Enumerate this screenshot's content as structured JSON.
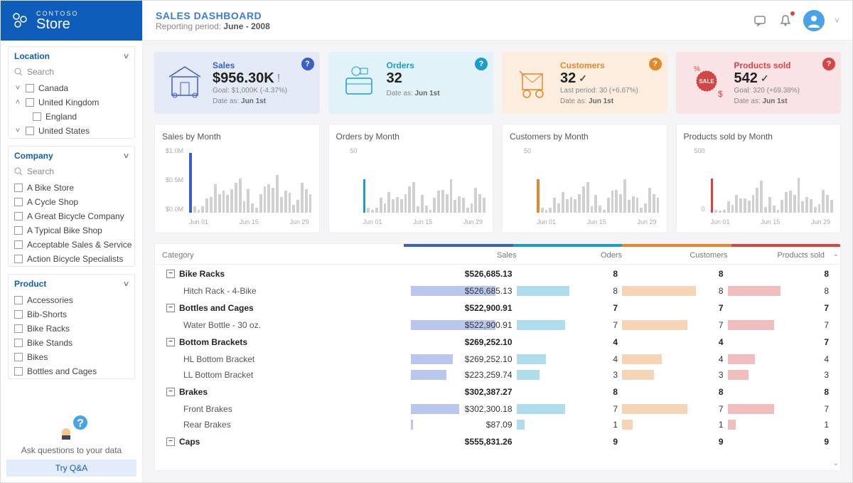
{
  "brand": {
    "sub": "CONTOSO",
    "main": "Store"
  },
  "header": {
    "title": "SALES DASHBOARD",
    "sub_prefix": "Reporting period:",
    "sub_period": "June - 2008"
  },
  "filters": {
    "location": {
      "title": "Location",
      "search": "Search",
      "items": [
        {
          "label": "Canada",
          "indent": 0,
          "carat": "˅"
        },
        {
          "label": "United Kingdom",
          "indent": 0,
          "carat": "˄"
        },
        {
          "label": "England",
          "indent": 1,
          "carat": ""
        },
        {
          "label": "United States",
          "indent": 0,
          "carat": "˅"
        }
      ]
    },
    "company": {
      "title": "Company",
      "search": "Search",
      "items": [
        {
          "label": "A Bike Store"
        },
        {
          "label": "A Cycle Shop"
        },
        {
          "label": "A Great Bicycle Company"
        },
        {
          "label": "A Typical Bike Shop"
        },
        {
          "label": "Acceptable Sales & Service"
        },
        {
          "label": "Action Bicycle Specialists"
        }
      ]
    },
    "product": {
      "title": "Product",
      "items": [
        {
          "label": "Accessories"
        },
        {
          "label": "Bib-Shorts"
        },
        {
          "label": "Bike Racks"
        },
        {
          "label": "Bike Stands"
        },
        {
          "label": "Bikes"
        },
        {
          "label": "Bottles and Cages"
        }
      ]
    }
  },
  "qa": {
    "text": "Ask questions to your data",
    "button": "Try Q&A"
  },
  "kpis": {
    "sales": {
      "label": "Sales",
      "value": "$956.30K",
      "sub": "Goal: $1,000K (-4.37%)",
      "date_prefix": "Date as:",
      "date": "Jun 1st",
      "icon": "!"
    },
    "orders": {
      "label": "Orders",
      "value": "32",
      "sub": "",
      "date_prefix": "Date as:",
      "date": "Jun 1st"
    },
    "customers": {
      "label": "Customers",
      "value": "32",
      "sub": "Last period: 30 (+6.67%)",
      "date_prefix": "Date as:",
      "date": "Jun 1st",
      "icon": "✓"
    },
    "products": {
      "label": "Products sold",
      "value": "542",
      "sub": "Goal: 320 (+69.38%)",
      "date_prefix": "Date as:",
      "date": "Jun 1st",
      "icon": "✓"
    }
  },
  "chart_data": [
    {
      "type": "bar",
      "title": "Sales by Month",
      "ylabel": "",
      "ylim": [
        0,
        1.0
      ],
      "yticks": [
        "$1.0M",
        "$0.5M",
        "$0.0M"
      ],
      "xticks": [
        "Jun 01",
        "Jun 15",
        "Jun 29"
      ],
      "highlight": 0,
      "hlclass": "hl-blue",
      "values": [
        0.96,
        0.1,
        0.05,
        0.1,
        0.23,
        0.25,
        0.45,
        0.3,
        0.35,
        0.28,
        0.38,
        0.48,
        0.55,
        0.18,
        0.38,
        0.15,
        0.08,
        0.3,
        0.42,
        0.45,
        0.4,
        0.6,
        0.25,
        0.35,
        0.32,
        0.12,
        0.2,
        0.48,
        0.38,
        0.3
      ]
    },
    {
      "type": "bar",
      "title": "Orders by Month",
      "ylabel": "",
      "ylim": [
        0,
        60
      ],
      "yticks": [
        "50"
      ],
      "xticks": [
        "Jun 01",
        "Jun 15",
        "Jun 29"
      ],
      "highlight": 0,
      "hlclass": "hl-cyan",
      "values": [
        32,
        5,
        3,
        5,
        14,
        9,
        20,
        13,
        15,
        13,
        18,
        25,
        29,
        6,
        17,
        7,
        3,
        14,
        21,
        22,
        18,
        32,
        12,
        16,
        14,
        5,
        9,
        24,
        18,
        14
      ]
    },
    {
      "type": "bar",
      "title": "Customers by Month",
      "ylabel": "",
      "ylim": [
        0,
        60
      ],
      "yticks": [
        "50"
      ],
      "xticks": [
        "Jun 01",
        "Jun 15",
        "Jun 29"
      ],
      "highlight": 0,
      "hlclass": "hl-orange",
      "values": [
        32,
        5,
        3,
        5,
        14,
        9,
        20,
        13,
        15,
        13,
        18,
        25,
        29,
        6,
        17,
        7,
        3,
        14,
        21,
        22,
        18,
        32,
        12,
        16,
        14,
        5,
        9,
        24,
        18,
        14
      ]
    },
    {
      "type": "bar",
      "title": "Products sold by Month",
      "ylabel": "",
      "ylim": [
        0,
        1000
      ],
      "yticks": [
        "500",
        "0"
      ],
      "xticks": [
        "Jun 01",
        "Jun 15",
        "Jun 29"
      ],
      "highlight": 0,
      "hlclass": "hl-red",
      "values": [
        542,
        44,
        30,
        40,
        180,
        120,
        280,
        230,
        230,
        190,
        280,
        400,
        510,
        90,
        250,
        110,
        40,
        210,
        330,
        350,
        280,
        560,
        180,
        250,
        220,
        90,
        140,
        360,
        280,
        200
      ]
    }
  ],
  "table": {
    "columns": [
      "Category",
      "Sales",
      "Oders",
      "Customers",
      "Products sold"
    ],
    "rows": [
      {
        "type": "cat",
        "label": "Bike Racks",
        "sales": "$526,685.13",
        "orders": "8",
        "customers": "8",
        "products": "8"
      },
      {
        "type": "sub",
        "label": "Hitch Rack - 4-Bike",
        "sales": "$526,685.13",
        "orders": "8",
        "customers": "8",
        "products": "8",
        "bars": {
          "s": 80,
          "o": 50,
          "c": 70,
          "p": 50
        }
      },
      {
        "type": "cat",
        "label": "Bottles and Cages",
        "sales": "$522,900.91",
        "orders": "7",
        "customers": "7",
        "products": "7"
      },
      {
        "type": "sub",
        "label": "Water Bottle - 30 oz.",
        "sales": "$522,900.91",
        "orders": "7",
        "customers": "7",
        "products": "7",
        "bars": {
          "s": 80,
          "o": 46,
          "c": 62,
          "p": 44
        }
      },
      {
        "type": "cat",
        "label": "Bottom Brackets",
        "sales": "$269,252.10",
        "orders": "4",
        "customers": "4",
        "products": "7"
      },
      {
        "type": "sub",
        "label": "HL Bottom Bracket",
        "sales": "$269,252.10",
        "orders": "4",
        "customers": "4",
        "products": "4",
        "bars": {
          "s": 40,
          "o": 28,
          "c": 38,
          "p": 26
        }
      },
      {
        "type": "sub",
        "label": "LL Bottom Bracket",
        "sales": "$223,259.74",
        "orders": "3",
        "customers": "3",
        "products": "3",
        "bars": {
          "s": 34,
          "o": 22,
          "c": 30,
          "p": 20
        }
      },
      {
        "type": "cat",
        "label": "Brakes",
        "sales": "$302,387.27",
        "orders": "8",
        "customers": "8",
        "products": "8"
      },
      {
        "type": "sub",
        "label": "Front Brakes",
        "sales": "$302,300.18",
        "orders": "7",
        "customers": "7",
        "products": "7",
        "bars": {
          "s": 46,
          "o": 46,
          "c": 62,
          "p": 44
        }
      },
      {
        "type": "sub",
        "label": "Rear Brakes",
        "sales": "$87.09",
        "orders": "1",
        "customers": "1",
        "products": "1",
        "bars": {
          "s": 2,
          "o": 8,
          "c": 10,
          "p": 8
        }
      },
      {
        "type": "cat",
        "label": "Caps",
        "sales": "$555,831.26",
        "orders": "9",
        "customers": "9",
        "products": "9"
      }
    ]
  }
}
